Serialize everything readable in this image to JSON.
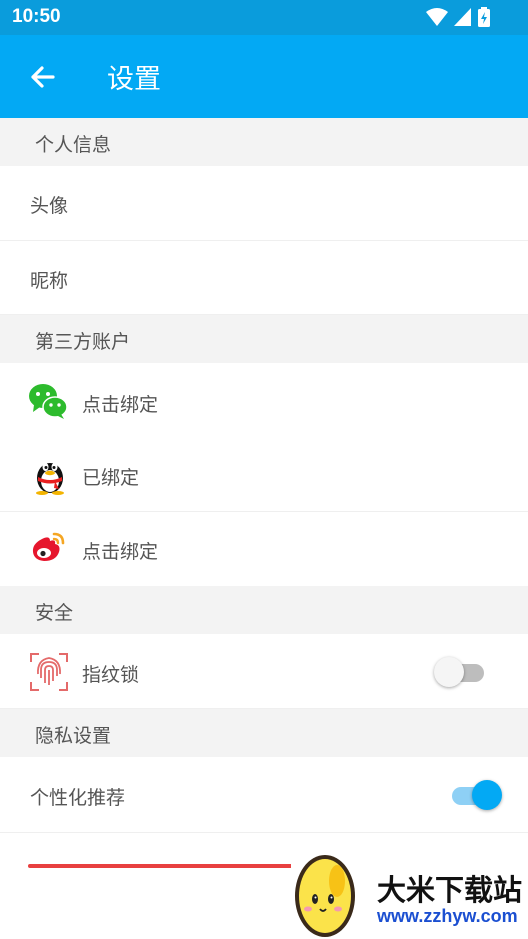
{
  "status_bar": {
    "time": "10:50",
    "icons": [
      "wifi-icon",
      "signal-icon",
      "battery-charging-icon"
    ]
  },
  "app_bar": {
    "back_icon": "arrow-left-icon",
    "title": "设置"
  },
  "sections": {
    "personal": {
      "header": "个人信息",
      "avatar_label": "头像",
      "nickname_label": "昵称"
    },
    "third_party": {
      "header": "第三方账户",
      "wechat": {
        "icon": "wechat-icon",
        "status": "点击绑定"
      },
      "qq": {
        "icon": "qq-icon",
        "status": "已绑定"
      },
      "weibo": {
        "icon": "weibo-icon",
        "status": "点击绑定"
      }
    },
    "security": {
      "header": "安全",
      "fingerprint": {
        "icon": "fingerprint-icon",
        "label": "指纹锁",
        "enabled": false
      }
    },
    "privacy": {
      "header": "隐私设置",
      "personalized": {
        "label": "个性化推荐",
        "enabled": true
      }
    }
  },
  "watermark": {
    "name": "大米下载站",
    "url": "www.zzhyw.com"
  },
  "colors": {
    "app_bar": "#03a9f4",
    "status_bar": "#0a9cdc",
    "section_bg": "#f3f3f3",
    "toggle_on": "#03a9f4",
    "red_line": "#e84040"
  }
}
